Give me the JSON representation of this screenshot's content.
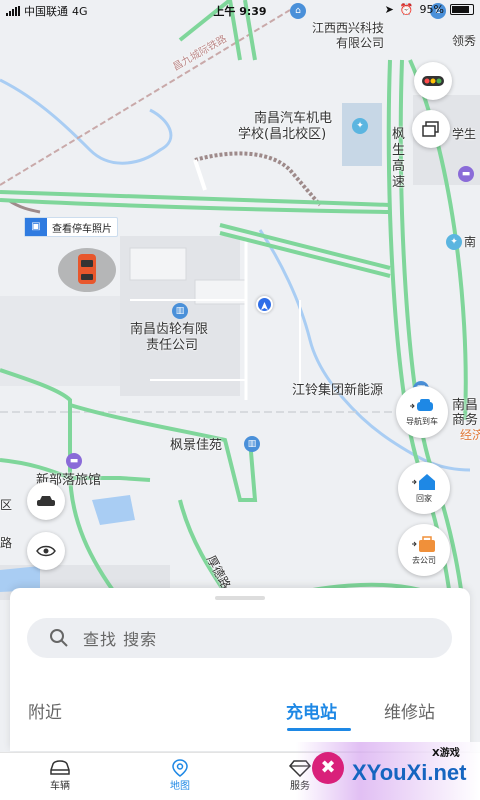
{
  "status_bar": {
    "carrier": "中国联通",
    "network": "4G",
    "time": "上午 9:39",
    "battery": "95%"
  },
  "map": {
    "labels": {
      "top_company_line1": "江西西兴科技",
      "top_company_line2": "有限公司",
      "top_right": "领秀",
      "railway": "昌九城际铁路",
      "school_line1": "南昌汽车机电",
      "school_line2": "学校(昌北校区)",
      "highway_1": "枫",
      "highway_2": "生",
      "highway_3": "高",
      "highway_4": "速",
      "edge_student": "学生",
      "edge_nan": "南",
      "gear_company_line1": "南昌齿轮有限",
      "gear_company_line2": "责任公司",
      "jiangling": "江铃集团新能源",
      "fengjing": "枫景佳苑",
      "edge_nanchang_line1": "南昌",
      "edge_nanchang_line2": "商务",
      "edge_jing": "经济",
      "xinbuluo": "新部落旅馆",
      "edge_qu": "区",
      "edge_lu": "路",
      "houde_road": "厚德路"
    },
    "parking_tag": "查看停车照片"
  },
  "map_buttons": {
    "navigate_to_car": "导航到车",
    "home": "回家",
    "company": "去公司"
  },
  "sheet": {
    "search_placeholder": "查找  搜索",
    "tabs": [
      "附近",
      "充电站",
      "维修站"
    ],
    "active_tab": "充电站"
  },
  "bottom_nav": {
    "items": [
      "车辆",
      "地图",
      "服务"
    ],
    "active": "地图"
  },
  "watermark": {
    "text": "XYouXi.net",
    "small": "X游戏",
    "logo_char": "✖"
  },
  "colors": {
    "accent": "#1e88e5",
    "road_green": "#7fd69a",
    "map_bg": "#eef0f3",
    "water": "#a9cdf3"
  }
}
